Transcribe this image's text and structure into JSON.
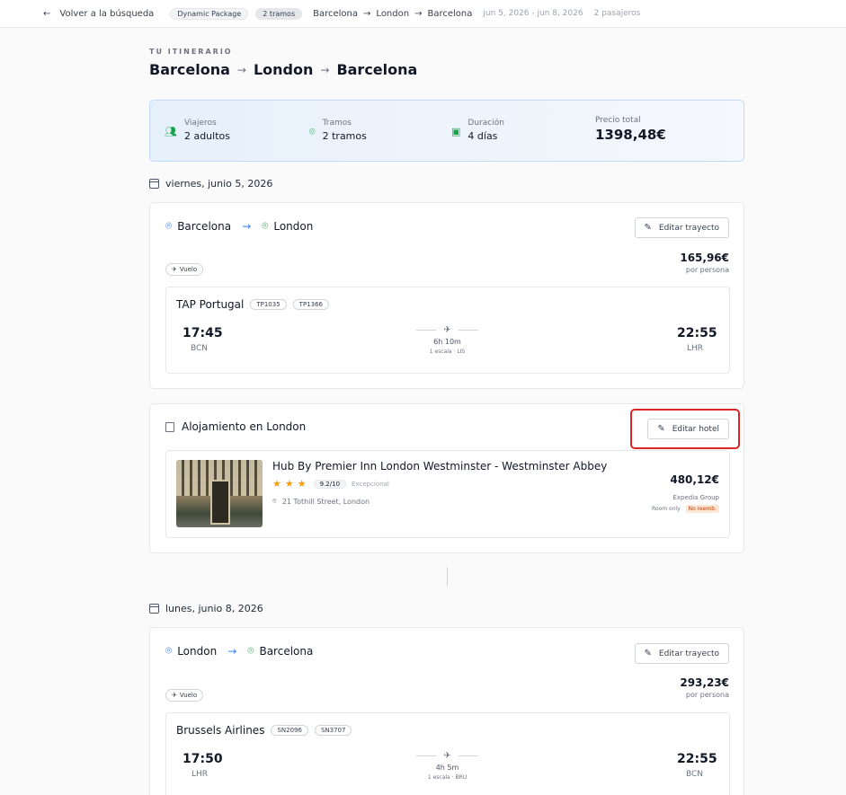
{
  "topbar": {
    "back_label": "Volver a la búsqueda",
    "package_badge": "Dynamic Package",
    "legs_badge": "2 tramos",
    "route": [
      "Barcelona",
      "London",
      "Barcelona"
    ],
    "dates": "jun 5, 2026 - jun 8, 2026",
    "passengers": "2 pasajeros"
  },
  "itinerary": {
    "eyebrow": "TU ITINERARIO",
    "title_cities": [
      "Barcelona",
      "London",
      "Barcelona"
    ]
  },
  "summary": {
    "travelers_label": "Viajeros",
    "travelers_value": "2 adultos",
    "legs_label": "Tramos",
    "legs_value": "2 tramos",
    "duration_label": "Duración",
    "duration_value": "4 días",
    "total_label": "Precio total",
    "total_value": "1398,48€"
  },
  "day1": {
    "date": "viernes, junio 5, 2026",
    "leg": {
      "from": "Barcelona",
      "to": "London",
      "edit_label": "Editar trayecto",
      "tag": "Vuelo",
      "price": "165,96€",
      "price_note": "por persona",
      "airline": "TAP Portugal",
      "codes": [
        "TP1035",
        "TP1366"
      ],
      "dep_time": "17:45",
      "dep_code": "BCN",
      "duration": "6h 10m",
      "stops": "1 escala · LIS",
      "arr_time": "22:55",
      "arr_code": "LHR"
    },
    "hotel": {
      "heading": "Alojamiento en London",
      "edit_label": "Editar hotel",
      "name": "Hub By Premier Inn London Westminster - Westminster Abbey",
      "stars": 3,
      "score": "9.2/10",
      "score_word": "Excepcional",
      "address": "21 Tothill Street, London",
      "price": "480,12€",
      "provider": "Expedia Group",
      "board": "Room only",
      "refund": "No reemb."
    }
  },
  "day2": {
    "date": "lunes, junio 8, 2026",
    "leg": {
      "from": "London",
      "to": "Barcelona",
      "edit_label": "Editar trayecto",
      "tag": "Vuelo",
      "price": "293,23€",
      "price_note": "por persona",
      "airline": "Brussels Airlines",
      "codes": [
        "SN2096",
        "SN3707"
      ],
      "dep_time": "17:50",
      "dep_code": "LHR",
      "duration": "4h 5m",
      "stops": "1 escala · BRU",
      "arr_time": "22:55",
      "arr_code": "BCN"
    }
  },
  "icons": {
    "back": "arrow-left-icon",
    "arrow": "arrow-right-icon",
    "pin": "map-pin-icon",
    "plane": "plane-icon",
    "edit": "edit-icon",
    "calendar": "calendar-icon",
    "building": "building-icon",
    "users": "users-icon"
  },
  "colors": {
    "accent_blue": "#2563eb",
    "accent_green": "#16a34a",
    "star": "#f59e0b",
    "highlight": "#dc2626"
  }
}
